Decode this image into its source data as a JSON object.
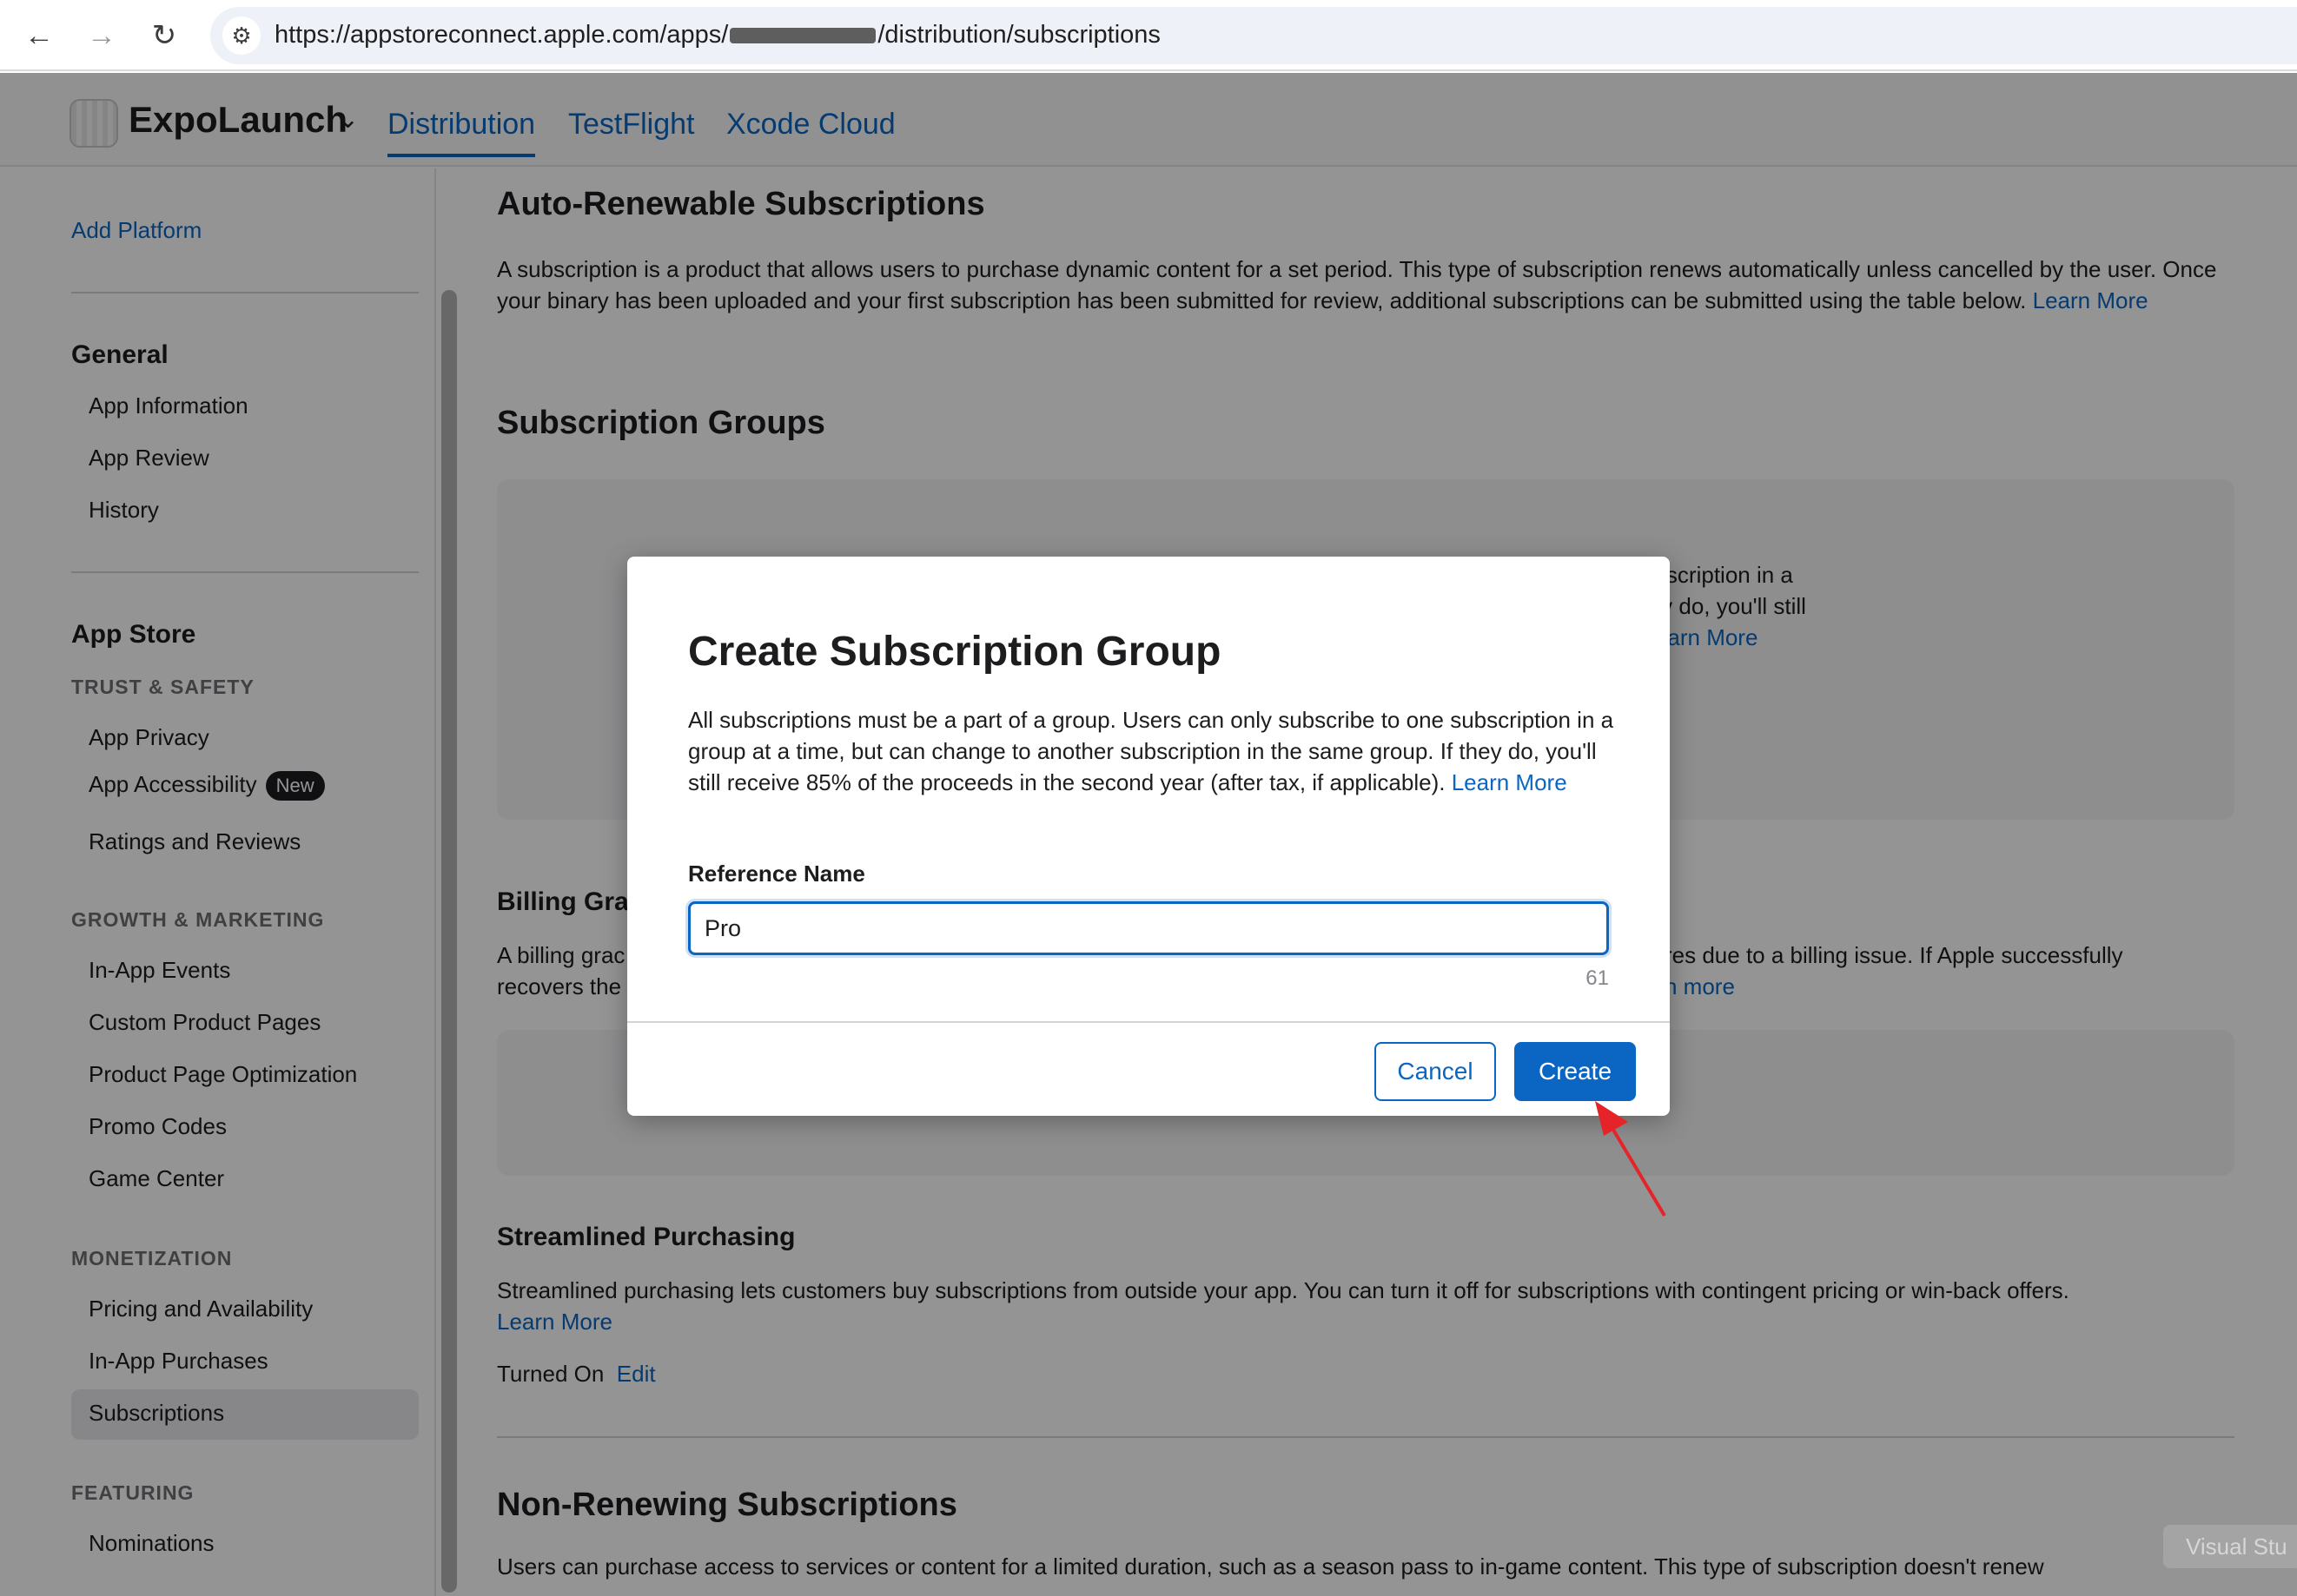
{
  "browser": {
    "url_prefix": "https://appstoreconnect.apple.com/apps/",
    "url_suffix": "/distribution/subscriptions"
  },
  "header": {
    "app_name": "ExpoLaunch",
    "tabs": [
      {
        "label": "Distribution",
        "active": true
      },
      {
        "label": "TestFlight",
        "active": false
      },
      {
        "label": "Xcode Cloud",
        "active": false
      }
    ]
  },
  "sidebar": {
    "add_platform": "Add Platform",
    "general": {
      "heading": "General",
      "items": [
        "App Information",
        "App Review",
        "History"
      ]
    },
    "app_store": {
      "heading": "App Store",
      "trust_safety": {
        "label": "TRUST & SAFETY",
        "items": [
          "App Privacy",
          "App Accessibility",
          "Ratings and Reviews"
        ],
        "new_badge": "New"
      },
      "growth": {
        "label": "GROWTH & MARKETING",
        "items": [
          "In-App Events",
          "Custom Product Pages",
          "Product Page Optimization",
          "Promo Codes",
          "Game Center"
        ]
      },
      "monetization": {
        "label": "MONETIZATION",
        "items": [
          "Pricing and Availability",
          "In-App Purchases",
          "Subscriptions"
        ],
        "selected": "Subscriptions"
      },
      "featuring": {
        "label": "FEATURING",
        "items": [
          "Nominations"
        ]
      }
    }
  },
  "main": {
    "auto_renew": {
      "title": "Auto-Renewable Subscriptions",
      "desc": "A subscription is a product that allows users to purchase dynamic content for a set period. This type of subscription renews automatically unless cancelled by the user. Once your binary has been uploaded and your first subscription has been submitted for review, additional subscriptions can be submitted using the table below.",
      "learn_more": "Learn More"
    },
    "groups": {
      "title": "Subscription Groups",
      "visible_line1": "subscription in a",
      "visible_line2": "they do, you'll still",
      "visible_line3": ".",
      "learn_more": "Learn More"
    },
    "billing": {
      "title": "Billing Gra",
      "line1_left": "A billing grac",
      "line1_right": "res due to a billing issue. If Apple successfully",
      "line2_left": "recovers the",
      "line2_right": "n more"
    },
    "streamlined": {
      "title": "Streamlined Purchasing",
      "desc": "Streamlined purchasing lets customers buy subscriptions from outside your app. You can turn it off for subscriptions with contingent pricing or win-back offers.",
      "learn_more": "Learn More",
      "status": "Turned On",
      "edit": "Edit"
    },
    "non_renewing": {
      "title": "Non-Renewing Subscriptions",
      "desc": "Users can purchase access to services or content for a limited duration, such as a season pass to in-game content. This type of subscription doesn't renew"
    }
  },
  "modal": {
    "title": "Create Subscription Group",
    "desc": "All subscriptions must be a part of a group. Users can only subscribe to one subscription in a group at a time, but can change to another subscription in the same group. If they do, you'll still receive 85% of the proceeds in the second year (after tax, if applicable).",
    "learn_more": "Learn More",
    "field_label": "Reference Name",
    "field_value": "Pro",
    "char_counter": "61",
    "cancel": "Cancel",
    "create": "Create"
  },
  "overlay_chip": "Visual Stu",
  "colors": {
    "accent": "#0a66c2",
    "annotation_arrow": "#e5242a"
  }
}
